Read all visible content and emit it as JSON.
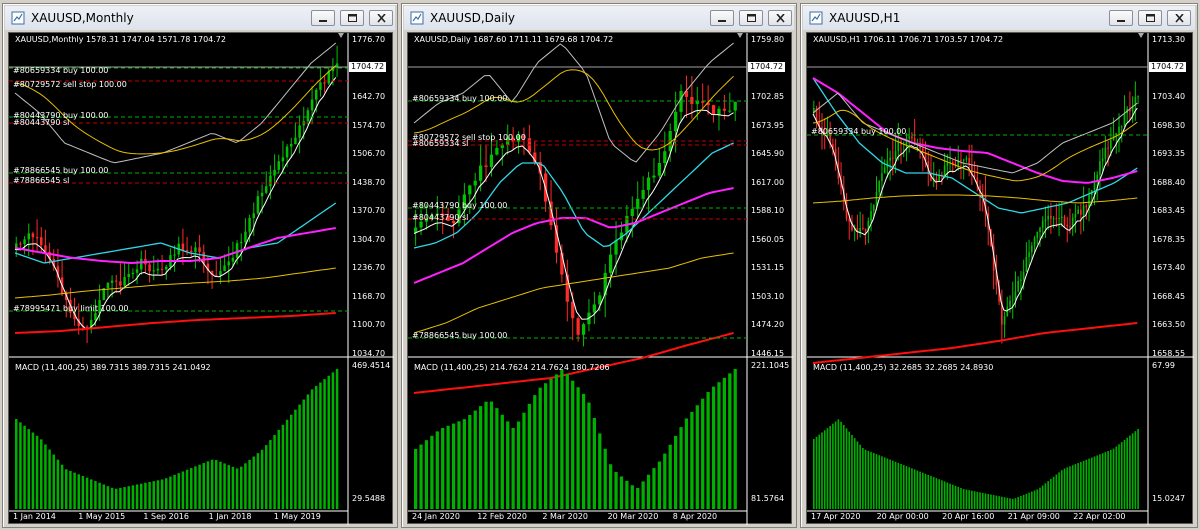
{
  "windows": [
    {
      "title": "XAUUSD,Monthly",
      "ohlc": "XAUUSD,Monthly  1578.31 1747.04 1571.78 1704.72",
      "current_price": "1704.72",
      "price_labels": [
        "1776.70",
        "1710.22",
        "1642.70",
        "1574.70",
        "1506.70",
        "1438.70",
        "1370.70",
        "1304.70",
        "1236.70",
        "1168.70",
        "1100.70",
        "1034.70"
      ],
      "orders": [
        "#80659334 buy 100.00",
        "#80729572 sell stop 100.00",
        "#80443790 buy 100.00",
        "#80443790 sl",
        "#78866545 buy 100.00",
        "#78866545 sl",
        "#78995471 buy limit 100.00"
      ],
      "macd_label": "MACD (11,400,25) 389.7315 389.7315 241.0492",
      "macd_labels": [
        "469.4514",
        "29.5488"
      ],
      "dates": [
        "1 Jan 2014",
        "1 May 2015",
        "1 Sep 2016",
        "1 Jan 2018",
        "1 May 2019"
      ]
    },
    {
      "title": "XAUUSD,Daily",
      "ohlc": "XAUUSD,Daily  1687.60 1711.11 1679.68 1704.72",
      "current_price": "1704.72",
      "price_labels": [
        "1759.80",
        "1730.90",
        "1702.85",
        "1673.95",
        "1645.90",
        "1617.00",
        "1588.10",
        "1560.05",
        "1531.15",
        "1503.10",
        "1474.20",
        "1446.15"
      ],
      "orders": [
        "#80659334 buy 100.00",
        "#80729572 sell stop 100.00",
        "#80659334 sl",
        "#80443790 buy 100.00",
        "#80443790 sl",
        "#78866545 buy 100.00"
      ],
      "macd_label": "MACD (11,400,25) 214.7624 214.7624 180.7206",
      "macd_labels": [
        "221.1045",
        "81.5764"
      ],
      "dates": [
        "24 Jan 2020",
        "12 Feb 2020",
        "2 Mar 2020",
        "20 Mar 2020",
        "8 Apr 2020"
      ]
    },
    {
      "title": "XAUUSD,H1",
      "ohlc": "XAUUSD,H1  1706.11 1706.71 1703.57 1704.72",
      "current_price": "1704.72",
      "price_labels": [
        "1713.30",
        "1708.35",
        "1703.40",
        "1698.30",
        "1693.35",
        "1688.40",
        "1683.45",
        "1678.35",
        "1673.40",
        "1668.45",
        "1663.50",
        "1658.55"
      ],
      "orders": [
        "#80659334 buy 100.00"
      ],
      "macd_label": "MACD (11,400,25) 32.2685 32.2685 24.8930",
      "macd_labels": [
        "67.99",
        "15.0247"
      ],
      "dates": [
        "17 Apr 2020",
        "20 Apr 00:00",
        "20 Apr 16:00",
        "21 Apr 09:00",
        "22 Apr 02:00"
      ]
    }
  ],
  "colors": {
    "bull": "#00c000",
    "bear": "#ff2a2a",
    "ema_white": "#ffffff",
    "ema_cyan": "#2fd8e8",
    "ema_magenta": "#ff20ff",
    "ema_gold": "#e8c000",
    "ema_red": "#ff1010",
    "level_green": "#00b000",
    "level_red": "#c00000",
    "macd_hist": "#00b000",
    "macd_line": "#c0c0c0",
    "signal_line": "#e8c000"
  }
}
